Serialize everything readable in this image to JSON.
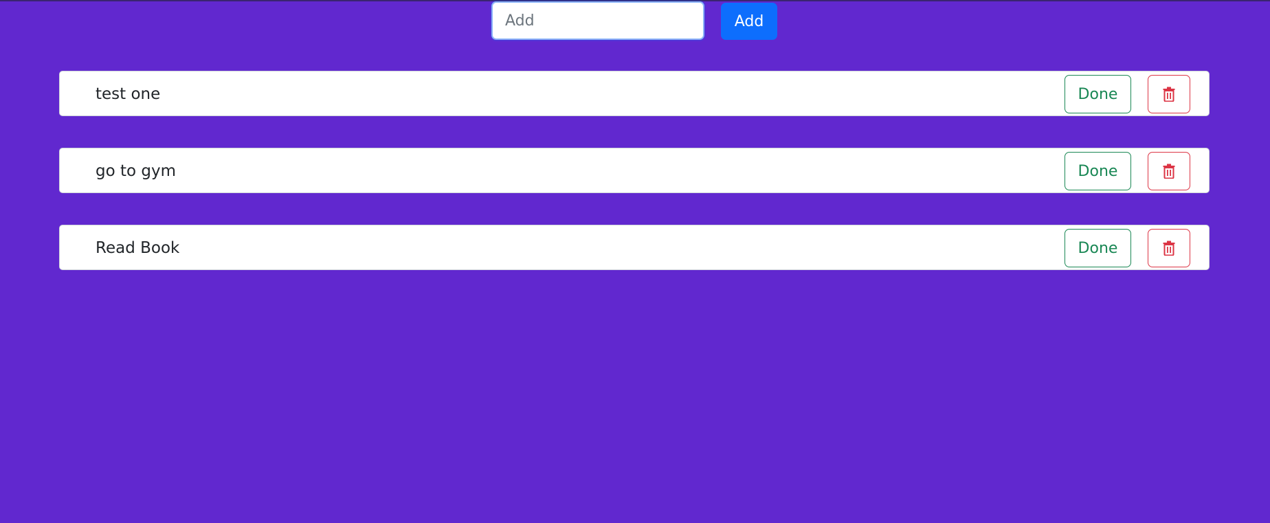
{
  "add_form": {
    "input_value": "",
    "input_placeholder": "Add",
    "add_button_label": "Add"
  },
  "todos": [
    {
      "text": "test one",
      "done_label": "Done",
      "delete_icon": "trash-icon"
    },
    {
      "text": "go to gym",
      "done_label": "Done",
      "delete_icon": "trash-icon"
    },
    {
      "text": "Read Book",
      "done_label": "Done",
      "delete_icon": "trash-icon"
    }
  ],
  "colors": {
    "background": "#6128cf",
    "add_button": "#0d6efd",
    "done": "#198754",
    "delete": "#dc3545"
  }
}
